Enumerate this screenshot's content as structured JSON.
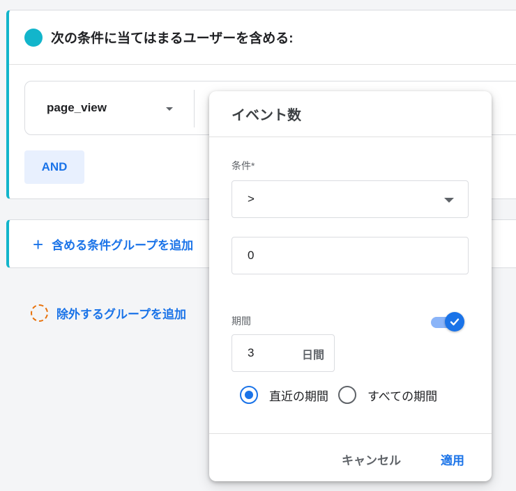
{
  "include_group": {
    "title": "次の条件に当てはまるユーザーを含める:",
    "event_select": "page_view",
    "and_button": "AND"
  },
  "add_include_group": {
    "icon": "plus-icon",
    "label": "含める条件グループを追加"
  },
  "add_exclude_group": {
    "icon": "dashed-circle-icon",
    "label": "除外するグループを追加"
  },
  "popup": {
    "title": "イベント数",
    "condition_label": "条件*",
    "operator_value": ">",
    "count_value": "0",
    "period_label": "期間",
    "period_toggle_on": true,
    "period_value": "3",
    "period_unit": "日間",
    "radio_recent": "直近の期間",
    "radio_all": "すべての期間",
    "selected_radio": "直近の期間",
    "cancel_button": "キャンセル",
    "apply_button": "適用"
  },
  "colors": {
    "accent": "#1a73e8",
    "group_teal": "#12b5cb",
    "exclude_orange": "#e8710a"
  }
}
